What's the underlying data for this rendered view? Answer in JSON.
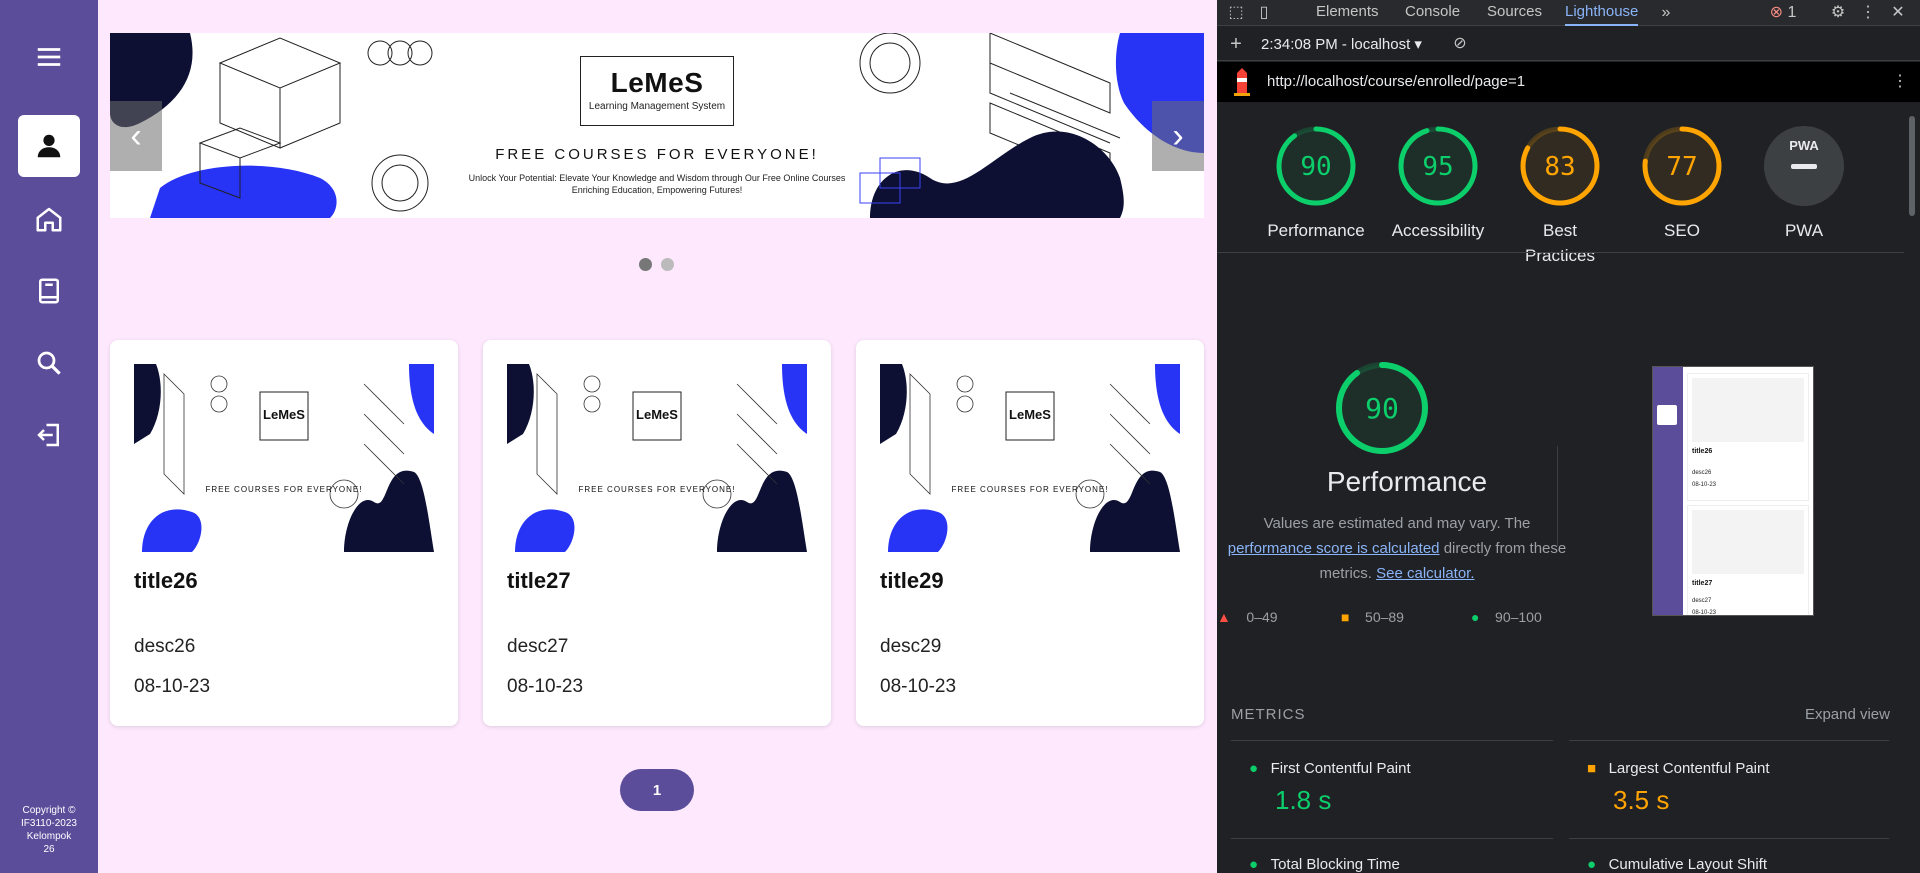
{
  "sidebar": {
    "copyright_lines": [
      "Copyright ©",
      "IF3110-2023",
      "Kelompok",
      "26"
    ]
  },
  "carousel": {
    "logo_title": "LeMeS",
    "logo_subtitle": "Learning Management System",
    "headline": "FREE COURSES FOR EVERYONE!",
    "desc_line1": "Unlock Your Potential: Elevate Your Knowledge and Wisdom through Our Free Online Courses",
    "desc_line2": "Enriching Education, Empowering Futures!",
    "prev_glyph": "‹",
    "next_glyph": "›",
    "active_slide": 1,
    "slide_count": 2
  },
  "courses": [
    {
      "title": "title26",
      "desc": "desc26",
      "date": "08-10-23"
    },
    {
      "title": "title27",
      "desc": "desc27",
      "date": "08-10-23"
    },
    {
      "title": "title29",
      "desc": "desc29",
      "date": "08-10-23"
    }
  ],
  "pagination": {
    "current": "1"
  },
  "devtools": {
    "tabs": [
      "Elements",
      "Console",
      "Sources",
      "Lighthouse"
    ],
    "active_tab": "Lighthouse",
    "error_count": "1",
    "report_time": "2:34:08 PM - localhost",
    "url": "http://localhost/course/enrolled/page=1",
    "scores": [
      {
        "label": "Performance",
        "value": "90",
        "color": "#0cce6b"
      },
      {
        "label": "Accessibility",
        "value": "95",
        "color": "#0cce6b"
      },
      {
        "label": "Best Practices",
        "value": "83",
        "color": "#ffa400"
      },
      {
        "label": "SEO",
        "value": "77",
        "color": "#ffa400"
      },
      {
        "label": "PWA",
        "value": "PWA",
        "color": "#9aa0a6"
      }
    ],
    "performance": {
      "score": "90",
      "title": "Performance",
      "note_start": "Values are estimated and may vary. The",
      "note_link": "performance score is calculated",
      "note_mid": "directly from these",
      "note_end": "metrics.",
      "calc_link": "See calculator."
    },
    "legend": [
      "0–49",
      "50–89",
      "90–100"
    ],
    "metrics_label": "METRICS",
    "expand_label": "Expand view",
    "metrics": [
      {
        "name": "First Contentful Paint",
        "value": "1.8 s",
        "color": "#0cce6b"
      },
      {
        "name": "Largest Contentful Paint",
        "value": "3.5 s",
        "color": "#ffa400"
      },
      {
        "name": "Total Blocking Time",
        "value": "",
        "color": "#0cce6b"
      },
      {
        "name": "Cumulative Layout Shift",
        "value": "",
        "color": "#0cce6b"
      }
    ],
    "thumbnail": {
      "cards": [
        {
          "title": "title26",
          "desc": "desc26",
          "date": "08-10-23"
        },
        {
          "title": "title27",
          "desc": "desc27",
          "date": "08-10-23"
        }
      ]
    }
  }
}
